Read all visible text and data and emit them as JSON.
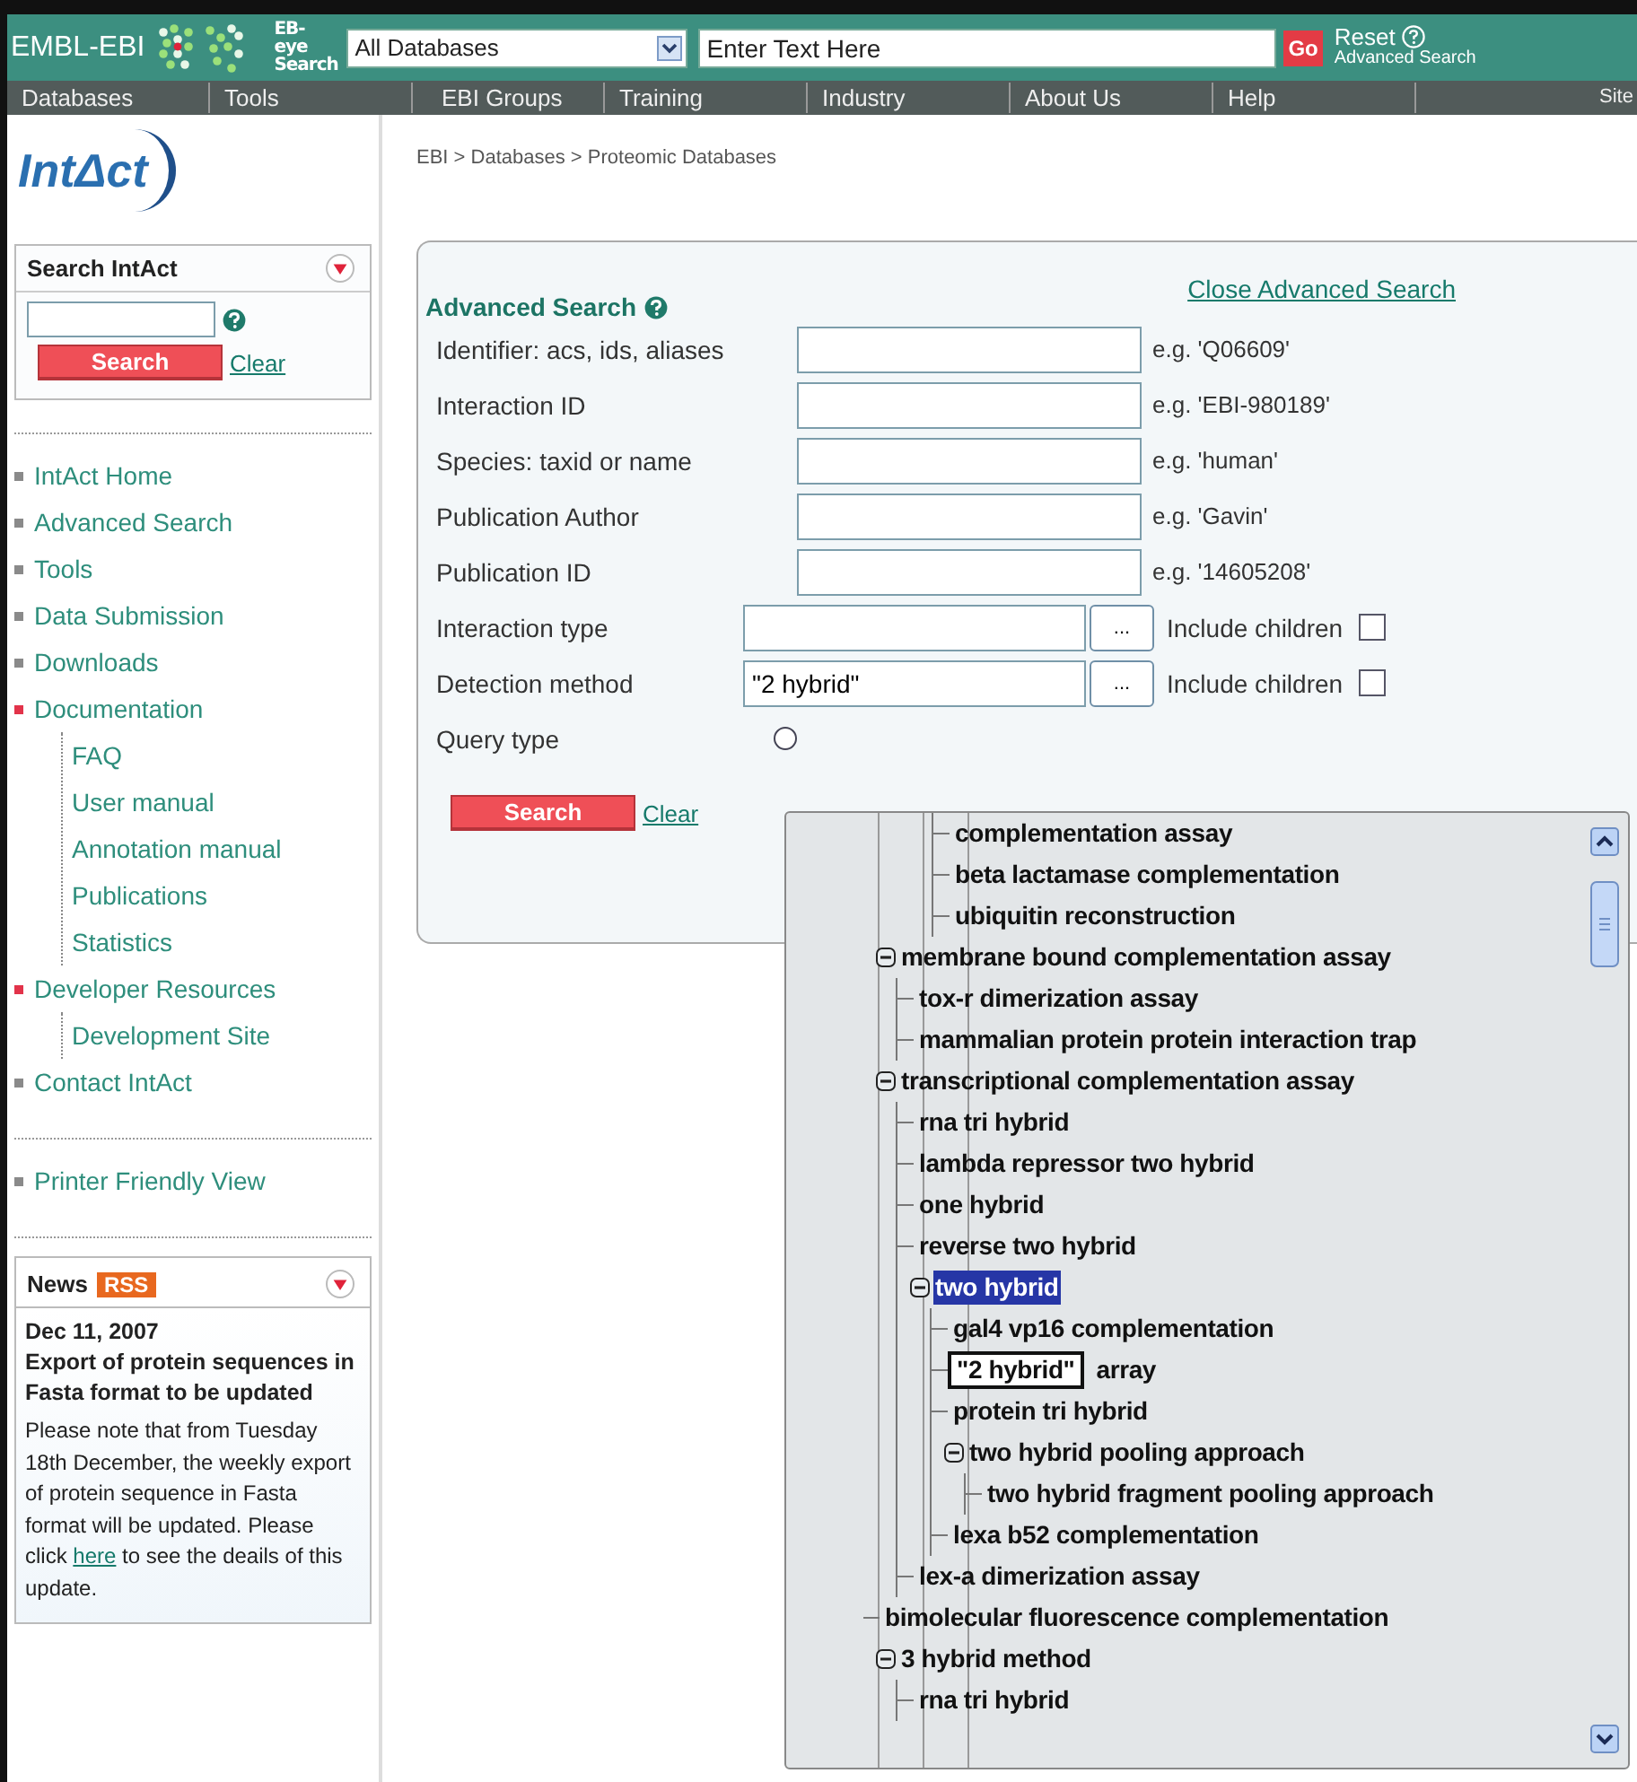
{
  "header": {
    "brand": "EMBL-EBI",
    "search_label": "EB-eye Search",
    "database_select": "All Databases",
    "search_placeholder": "Enter Text Here",
    "go_button": "Go",
    "reset_link": "Reset",
    "advanced_link": "Advanced Search"
  },
  "nav": [
    "Databases",
    "Tools",
    "EBI Groups",
    "Training",
    "Industry",
    "About Us",
    "Help",
    "Site"
  ],
  "sidebar": {
    "logo": "IntΔct",
    "search_box": {
      "title": "Search IntAct",
      "search_button": "Search",
      "clear_link": "Clear"
    },
    "menu": [
      {
        "label": "IntAct Home",
        "expanded": false
      },
      {
        "label": "Advanced Search",
        "expanded": false
      },
      {
        "label": "Tools",
        "expanded": false
      },
      {
        "label": "Data Submission",
        "expanded": false
      },
      {
        "label": "Downloads",
        "expanded": false
      },
      {
        "label": "Documentation",
        "expanded": true,
        "children": [
          "FAQ",
          "User manual",
          "Annotation manual",
          "Publications",
          "Statistics"
        ]
      },
      {
        "label": "Developer Resources",
        "expanded": true,
        "children": [
          "Development Site"
        ]
      },
      {
        "label": "Contact IntAct",
        "expanded": false
      }
    ],
    "extra_menu": [
      {
        "label": "Printer Friendly View",
        "expanded": false
      }
    ],
    "news": {
      "title": "News",
      "rss": "RSS",
      "date": "Dec 11, 2007",
      "headline": "Export of protein sequences in Fasta format to be updated",
      "text_before": "Please note that from Tuesday 18th December, the weekly export of protein sequence in Fasta format will be updated. Please click ",
      "link": "here",
      "text_after": " to see the deails of this update."
    }
  },
  "breadcrumb": "EBI > Databases > Proteomic Databases",
  "advanced_search": {
    "title": "Advanced Search",
    "close_link": "Close Advanced Search",
    "fields": [
      {
        "kind": "text",
        "label": "Identifier: acs, ids, aliases",
        "example": "e.g. 'Q06609'"
      },
      {
        "kind": "text",
        "label": "Interaction ID",
        "example": "e.g. 'EBI-980189'"
      },
      {
        "kind": "text",
        "label": "Species: taxid or name",
        "example": "e.g. 'human'"
      },
      {
        "kind": "text",
        "label": "Publication Author",
        "example": "e.g. 'Gavin'"
      },
      {
        "kind": "text",
        "label": "Publication ID",
        "example": "e.g. '14605208'"
      },
      {
        "kind": "ontology",
        "label": "Interaction type",
        "browse_button": "...",
        "include_label": "Include children",
        "include_children": false
      },
      {
        "kind": "ontology",
        "label": "Detection method",
        "value": "\"2 hybrid\"",
        "browse_button": "...",
        "include_label": "Include children",
        "include_children": false
      },
      {
        "kind": "radio",
        "label": "Query type",
        "options": [
          {
            "selected": false
          }
        ]
      }
    ],
    "search_button": "Search",
    "clear_link": "Clear"
  },
  "tree_popup": {
    "nodes": [
      {
        "children": [
          {
            "label": "complementation assay",
            "selected": false
          },
          {
            "label": "beta lactamase complementation",
            "selected": false
          },
          {
            "label": "ubiquitin reconstruction",
            "selected": false
          }
        ]
      },
      {
        "label": "membrane bound complementation assay",
        "selected": false,
        "expanded": true,
        "children": [
          {
            "label": "tox-r dimerization assay",
            "selected": false
          },
          {
            "label": "mammalian protein protein interaction trap",
            "selected": false
          }
        ]
      },
      {
        "label": "transcriptional complementation assay",
        "selected": false,
        "expanded": true,
        "children": [
          {
            "label": "rna tri hybrid",
            "selected": false
          },
          {
            "label": "lambda repressor two hybrid",
            "selected": false
          },
          {
            "label": "one hybrid",
            "selected": false
          },
          {
            "label": "reverse two hybrid",
            "selected": false
          },
          {
            "label": "two hybrid",
            "selected": true,
            "expanded": true,
            "children": [
              {
                "label": "gal4 vp16 complementation",
                "selected": false
              },
              {
                "label": "array",
                "selected": false,
                "tooltip": "\"2 hybrid\""
              },
              {
                "label": "protein tri hybrid",
                "selected": false
              },
              {
                "label": "two hybrid pooling approach",
                "selected": false,
                "expanded": true,
                "children": [
                  {
                    "label": "two hybrid fragment pooling approach",
                    "selected": false
                  }
                ]
              },
              {
                "label": "lexa b52 complementation",
                "selected": false
              }
            ]
          },
          {
            "label": "lex-a dimerization assay",
            "selected": false
          }
        ]
      },
      {
        "label": "bimolecular fluorescence complementation",
        "selected": false
      },
      {
        "label": "3 hybrid method",
        "selected": false,
        "expanded": true,
        "children": [
          {
            "label": "rna tri hybrid",
            "selected": false
          }
        ]
      }
    ]
  }
}
